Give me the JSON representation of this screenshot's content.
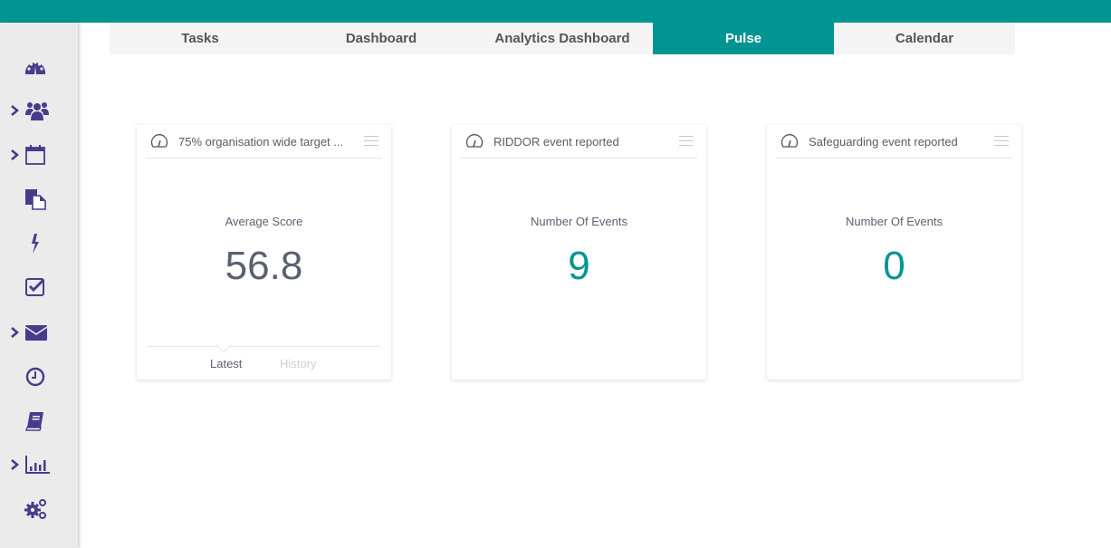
{
  "colors": {
    "accent": "#009593",
    "sidebar_icon": "#473c8b",
    "sidebar_bg": "#ebebeb",
    "tab_bg": "#f5f4f4"
  },
  "sidebar": {
    "items": [
      {
        "icon": "dashboard-gauge-icon",
        "has_chevron": false
      },
      {
        "icon": "users-icon",
        "has_chevron": true
      },
      {
        "icon": "calendar-icon",
        "has_chevron": true
      },
      {
        "icon": "documents-icon",
        "has_chevron": false
      },
      {
        "icon": "lightning-icon",
        "has_chevron": false
      },
      {
        "icon": "checkbox-icon",
        "has_chevron": false
      },
      {
        "icon": "envelope-icon",
        "has_chevron": true
      },
      {
        "icon": "clock-icon",
        "has_chevron": false
      },
      {
        "icon": "book-icon",
        "has_chevron": false
      },
      {
        "icon": "bar-chart-icon",
        "has_chevron": true
      },
      {
        "icon": "gears-icon",
        "has_chevron": false
      }
    ]
  },
  "tabs": [
    {
      "label": "Tasks",
      "active": false
    },
    {
      "label": "Dashboard",
      "active": false
    },
    {
      "label": "Analytics Dashboard",
      "active": false
    },
    {
      "label": "Pulse",
      "active": true
    },
    {
      "label": "Calendar",
      "active": false
    }
  ],
  "cards": [
    {
      "title": "75% organisation wide target ...",
      "metric_label": "Average Score",
      "metric_value": "56.8",
      "footer_tabs": {
        "latest": "Latest",
        "history": "History",
        "active": "latest"
      }
    },
    {
      "title": "RIDDOR event reported",
      "metric_label": "Number Of Events",
      "metric_value": "9"
    },
    {
      "title": "Safeguarding event reported",
      "metric_label": "Number Of Events",
      "metric_value": "0"
    }
  ]
}
